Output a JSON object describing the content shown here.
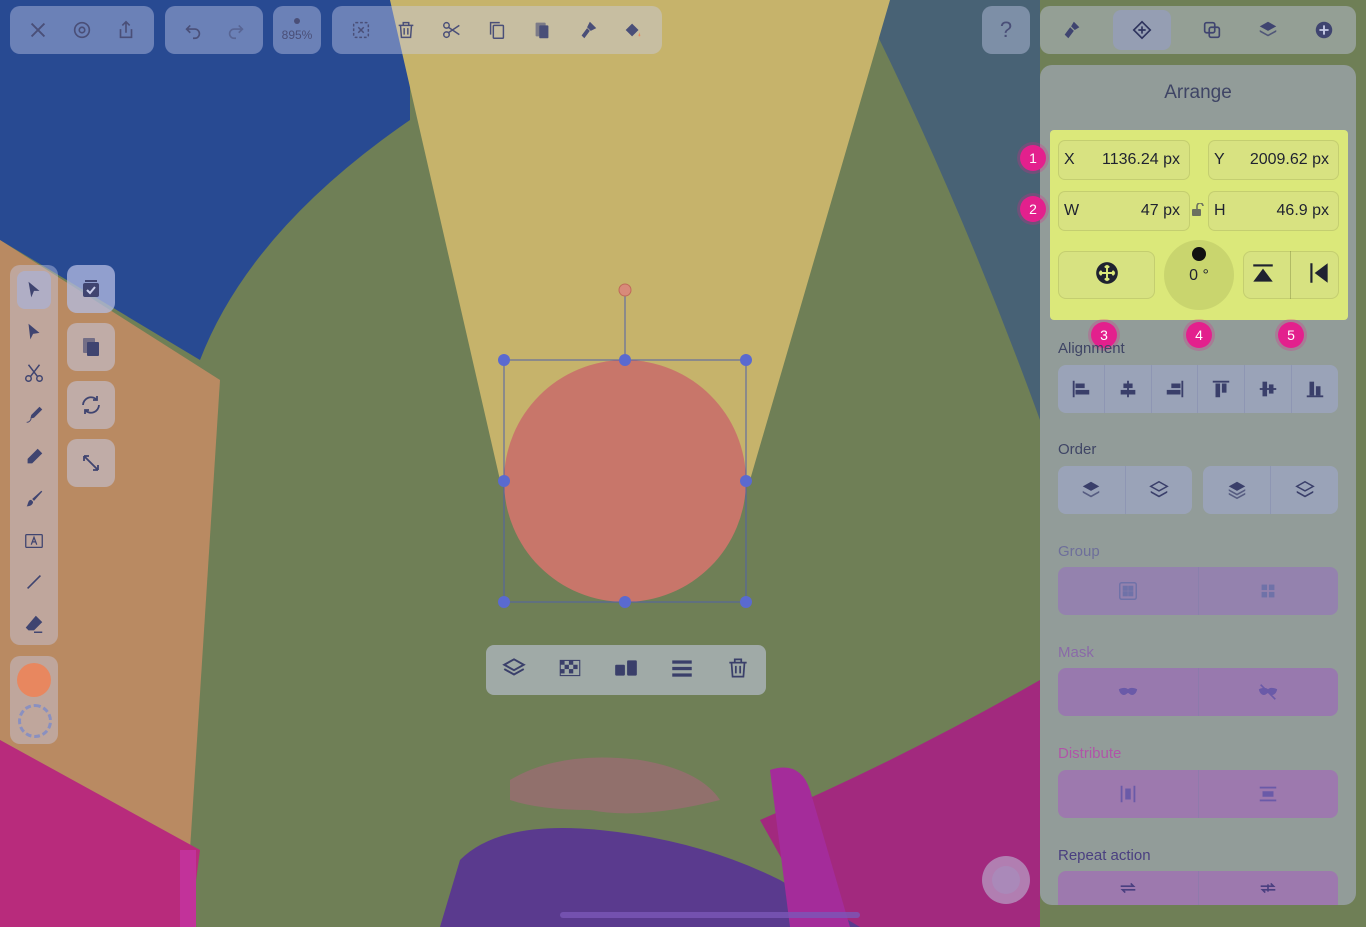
{
  "top_toolbar": {
    "group1": [
      "close-icon",
      "settings-icon",
      "share-icon"
    ],
    "group2": [
      "undo-icon",
      "redo-icon"
    ],
    "zoom": "895%",
    "group3": [
      "deselect-icon",
      "trash-icon",
      "cut-icon",
      "copy-icon",
      "paste-icon",
      "paste-style-icon",
      "fill-icon"
    ],
    "help": "?",
    "right_tabs": [
      "style-brush-icon",
      "arrange-icon",
      "boolean-icon",
      "layers-icon",
      "add-icon"
    ]
  },
  "left_tools": [
    "select-pointer-icon",
    "node-pointer-icon",
    "scissors-icon",
    "pen-icon",
    "pencil-icon",
    "brush-icon",
    "text-icon",
    "line-icon",
    "eraser-icon"
  ],
  "quick_actions": [
    "checkbox-icon",
    "duplicate-icon",
    "rotate-icon",
    "resize-icon"
  ],
  "colors": {
    "fill": "#e8875f",
    "stroke": "none",
    "accent": "#e3208d",
    "highlight": "#dbe87a"
  },
  "arrange": {
    "title": "Arrange",
    "x_label": "X",
    "x_value": "1136.24 px",
    "y_label": "Y",
    "y_value": "2009.62 px",
    "w_label": "W",
    "w_value": "47 px",
    "h_label": "H",
    "h_value": "46.9 px",
    "rotation": "0 °"
  },
  "badges": [
    "1",
    "2",
    "3",
    "4",
    "5"
  ],
  "sections": {
    "alignment": "Alignment",
    "order": "Order",
    "group": "Group",
    "mask": "Mask",
    "distribute": "Distribute",
    "repeat": "Repeat action"
  },
  "selection_toolbar": [
    "layers-icon",
    "checker-icon",
    "blocks-icon",
    "lines-icon",
    "trash-icon"
  ]
}
